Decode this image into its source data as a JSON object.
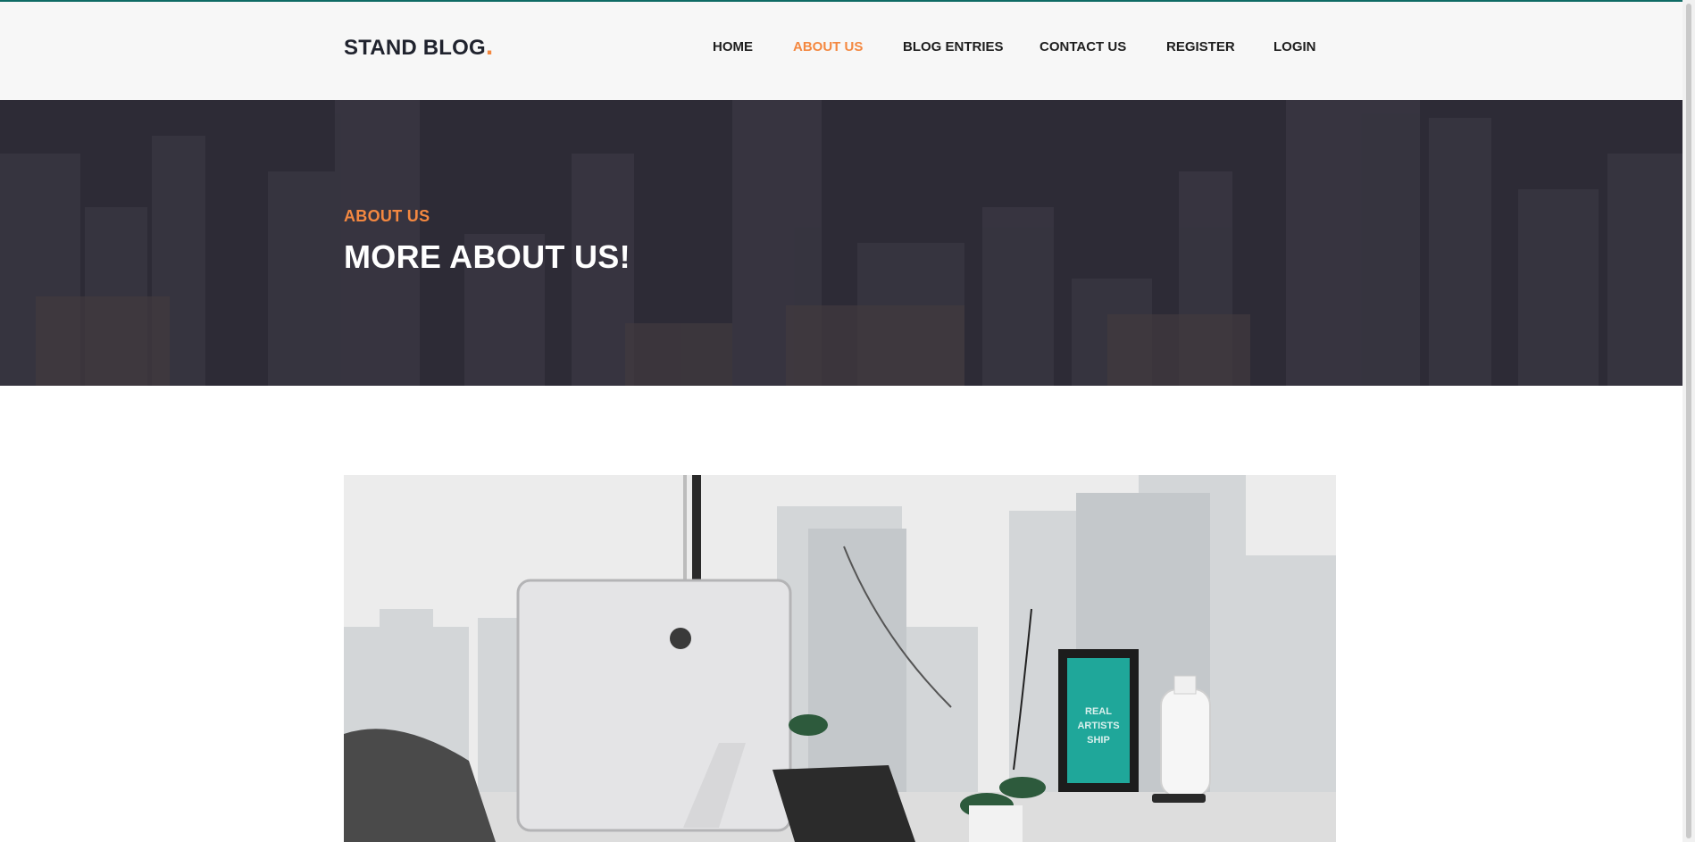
{
  "brand": {
    "name": "STAND BLOG",
    "dot": ".",
    "accent_color": "#f48840"
  },
  "nav": {
    "items": [
      {
        "label": "HOME",
        "active": false
      },
      {
        "label": "ABOUT US",
        "active": true
      },
      {
        "label": "BLOG ENTRIES",
        "active": false
      },
      {
        "label": "CONTACT US",
        "active": false
      },
      {
        "label": "REGISTER",
        "active": false
      },
      {
        "label": "LOGIN",
        "active": false
      }
    ]
  },
  "banner": {
    "subtitle": "ABOUT US",
    "title": "MORE ABOUT US!",
    "overlay_color": "#2d2b36"
  },
  "photo": {
    "frame_text": [
      "REAL",
      "ARTISTS",
      "SHIP"
    ]
  }
}
